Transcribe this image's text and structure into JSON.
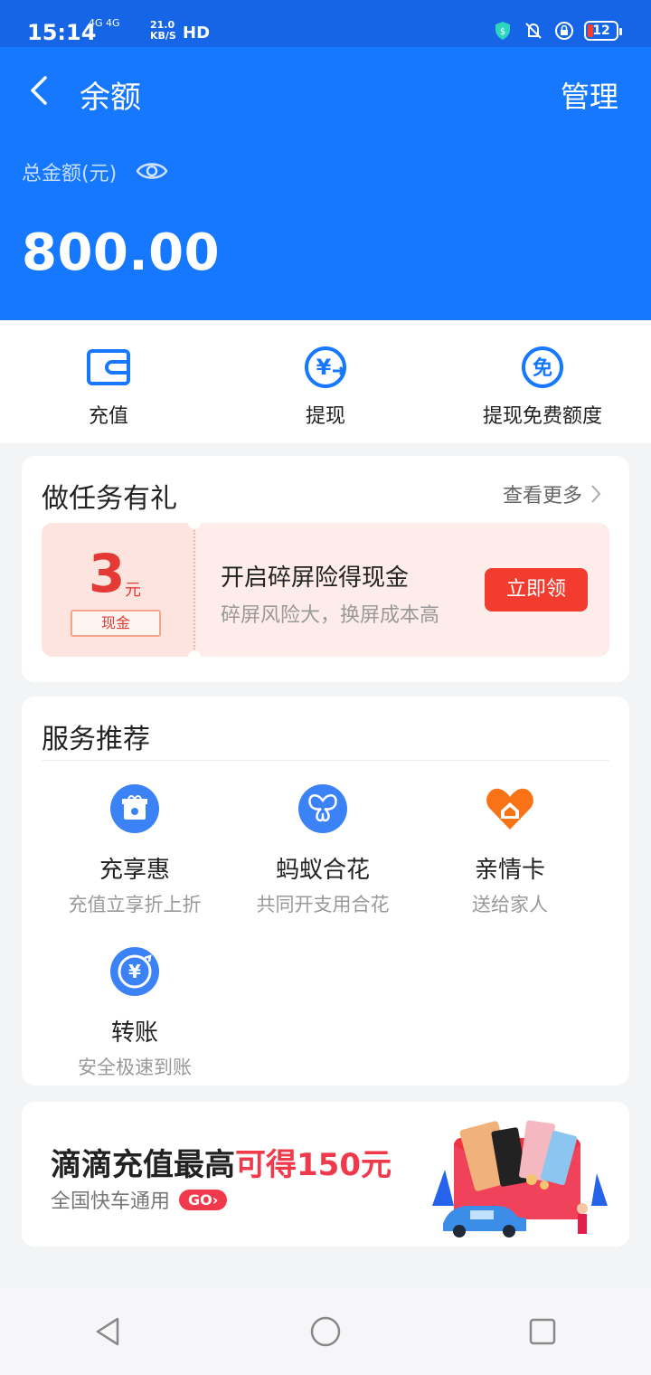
{
  "status_bar": {
    "time": "15:14",
    "network": "4G 4G",
    "speed_value": "21.0",
    "speed_unit": "KB/S",
    "hd": "HD",
    "battery": "12"
  },
  "header": {
    "title": "余额",
    "manage": "管理",
    "total_label": "总金额(元)",
    "amount": "800.00"
  },
  "quick_actions": [
    {
      "label": "充值"
    },
    {
      "label": "提现"
    },
    {
      "label": "提现免费额度"
    }
  ],
  "tasks": {
    "title": "做任务有礼",
    "more": "查看更多",
    "coupon": {
      "amount": "3",
      "unit": "元",
      "tag": "现金",
      "title": "开启碎屏险得现金",
      "subtitle": "碎屏风险大，换屏成本高",
      "button": "立即领"
    }
  },
  "services": {
    "title": "服务推荐",
    "items": [
      {
        "name": "充享惠",
        "desc": "充值立享折上折"
      },
      {
        "name": "蚂蚁合花",
        "desc": "共同开支用合花"
      },
      {
        "name": "亲情卡",
        "desc": "送给家人"
      },
      {
        "name": "转账",
        "desc": "安全极速到账"
      }
    ]
  },
  "banner": {
    "title_main": "滴滴充值最高",
    "title_highlight": "可得150元",
    "subtitle": "全国快车通用",
    "go": "GO›"
  },
  "colors": {
    "primary": "#1677ff",
    "red": "#f23c30"
  }
}
